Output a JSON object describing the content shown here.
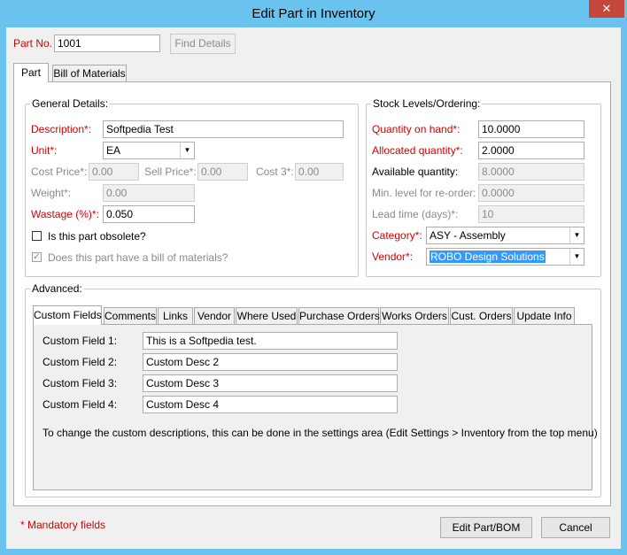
{
  "window": {
    "title": "Edit Part in Inventory",
    "close_glyph": "✕"
  },
  "header": {
    "part_no_label": "Part No.",
    "part_no_value": "1001",
    "find_details_label": "Find Details"
  },
  "main_tabs": [
    {
      "label": "Part"
    },
    {
      "label": "Bill of Materials"
    }
  ],
  "general": {
    "legend": "General Details:",
    "description_label": "Description*:",
    "description_value": "Softpedia Test",
    "unit_label": "Unit*:",
    "unit_value": "EA",
    "cost_price_label": "Cost Price*:",
    "cost_price_value": "0.00",
    "sell_price_label": "Sell Price*:",
    "sell_price_value": "0.00",
    "cost3_label": "Cost 3*:",
    "cost3_value": "0.00",
    "weight_label": "Weight*:",
    "weight_value": "0.00",
    "wastage_label": "Wastage (%)*:",
    "wastage_value": "0.050",
    "obsolete_label": "Is this part obsolete?",
    "bom_label": "Does this part have a bill of materials?",
    "bom_check": "✓"
  },
  "stock": {
    "legend": "Stock Levels/Ordering:",
    "qty_on_hand_label": "Quantity on hand*:",
    "qty_on_hand_value": "10.0000",
    "allocated_label": "Allocated quantity*:",
    "allocated_value": "2.0000",
    "available_label": "Available quantity:",
    "available_value": "8.0000",
    "min_level_label": "Min. level for re-order:",
    "min_level_value": "0.0000",
    "lead_time_label": "Lead time (days)*:",
    "lead_time_value": "10",
    "category_label": "Category*:",
    "category_value": "ASY - Assembly",
    "vendor_label": "Vendor*:",
    "vendor_value": "ROBO Design Solutions"
  },
  "advanced": {
    "legend": "Advanced:",
    "tabs": [
      {
        "label": "Custom Fields"
      },
      {
        "label": "Comments"
      },
      {
        "label": "Links"
      },
      {
        "label": "Vendor"
      },
      {
        "label": "Where Used"
      },
      {
        "label": "Purchase Orders"
      },
      {
        "label": "Works Orders"
      },
      {
        "label": "Cust. Orders"
      },
      {
        "label": "Update Info"
      }
    ],
    "custom_fields": [
      {
        "label": "Custom Field 1:",
        "value": "This is a Softpedia test."
      },
      {
        "label": "Custom Field 2:",
        "value": "Custom Desc 2"
      },
      {
        "label": "Custom Field 3:",
        "value": "Custom Desc 3"
      },
      {
        "label": "Custom Field 4:",
        "value": "Custom Desc 4"
      }
    ],
    "note": "To change the custom descriptions, this can be done in the settings area (Edit Settings > Inventory from the top menu)"
  },
  "footer": {
    "mandatory_note": "* Mandatory fields",
    "edit_bom_label": "Edit Part/BOM",
    "cancel_label": "Cancel"
  },
  "combo_arrow_glyph": "▼",
  "colors": {
    "title_bar": "#69c3ee",
    "close_button": "#c7463a",
    "required_label": "#d40000",
    "selection": "#3399ff"
  }
}
